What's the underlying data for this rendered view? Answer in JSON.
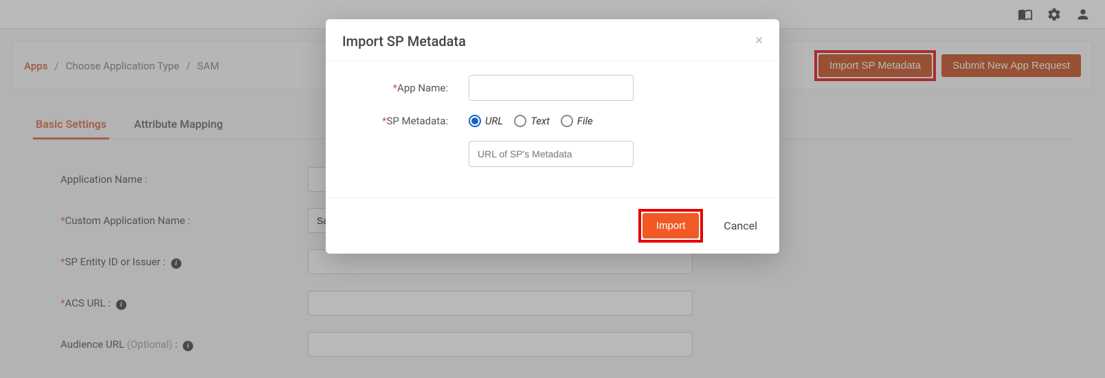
{
  "topbar": {
    "icons": [
      "book-icon",
      "gear-icon",
      "user-icon"
    ]
  },
  "breadcrumb": {
    "root": "Apps",
    "item1": "Choose Application Type",
    "item2": "SAM"
  },
  "header_buttons": {
    "import_sp": "Import SP Metadata",
    "submit_request": "Submit New App Request"
  },
  "tabs": {
    "basic": "Basic Settings",
    "attribute": "Attribute Mapping"
  },
  "form": {
    "app_name_label": "Application Name :",
    "custom_app_label": "Custom Application Name :",
    "custom_app_value": "Salesforce",
    "sp_entity_label": "SP Entity ID or Issuer :",
    "acs_label": "ACS URL :",
    "audience_label_part1": "Audience URL ",
    "audience_label_optional": "(Optional)",
    "audience_label_part2": " :"
  },
  "modal": {
    "title": "Import SP Metadata",
    "app_name_label": "App Name:",
    "sp_metadata_label": "SP Metadata:",
    "radio_url": "URL",
    "radio_text": "Text",
    "radio_file": "File",
    "url_placeholder": "URL of SP's Metadata",
    "import_btn": "Import",
    "cancel_btn": "Cancel"
  }
}
